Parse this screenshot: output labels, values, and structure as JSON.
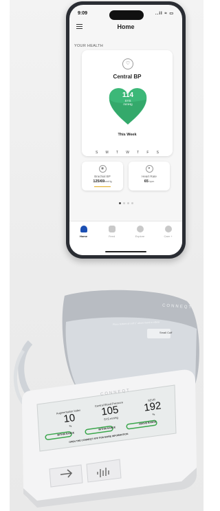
{
  "phone": {
    "status": {
      "time": "9:09",
      "signal": "..il ≈ ▭"
    },
    "header": {
      "title": "Home"
    },
    "section_label": "YOUR HEALTH",
    "card": {
      "title": "Central BP",
      "value": "114",
      "sub1": "SYS",
      "sub2": "mmHg",
      "period": "This Week",
      "days": [
        "S",
        "M",
        "T",
        "W",
        "T",
        "F",
        "S"
      ]
    },
    "tiles": [
      {
        "label": "Brachial BP",
        "value": "125/69",
        "unit": "mmHg"
      },
      {
        "label": "Heart Rate",
        "value": "65",
        "unit": "bpm"
      }
    ],
    "tabs": [
      {
        "label": "Home",
        "icon": "home-icon"
      },
      {
        "label": "Feed",
        "icon": "feed-icon"
      },
      {
        "label": "Explore",
        "icon": "explore-icon"
      },
      {
        "label": "Care +",
        "icon": "care-icon"
      }
    ],
    "accent": "#1b4fb3",
    "heart_color": "#3cb878"
  },
  "device": {
    "brand": "CONNEQT",
    "cuff_brand": "CONNEQT",
    "cuff_text": "Place bottom of cuff 1\" above bend in elbow",
    "cuff_size": "Small Cuff",
    "readings": [
      {
        "label": "Augmentation Index",
        "value": "10",
        "unit": "%",
        "range": "WITHIN RANGE"
      },
      {
        "label": "Central Blood Pressure",
        "value": "105",
        "unit": "SYS mmHg",
        "range": "WITHIN RANGE"
      },
      {
        "label": "SEVR",
        "value": "192",
        "unit": "%",
        "range": "ABOVE RANGE"
      }
    ],
    "footer_text": "OPEN THE CONNEQT APP FOR MORE INFORMATION",
    "range_color": "#3aa64b"
  }
}
